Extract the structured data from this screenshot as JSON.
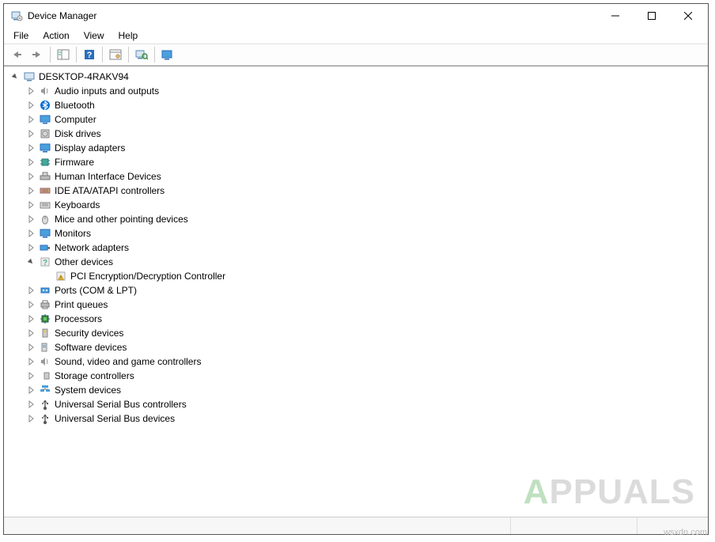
{
  "window": {
    "title": "Device Manager"
  },
  "menubar": {
    "items": [
      {
        "label": "File"
      },
      {
        "label": "Action"
      },
      {
        "label": "View"
      },
      {
        "label": "Help"
      }
    ]
  },
  "toolbar": {
    "buttons": [
      {
        "name": "back",
        "icon": "arrow-left"
      },
      {
        "name": "forward",
        "icon": "arrow-right"
      },
      {
        "name": "show-hide-tree",
        "icon": "tree-pane"
      },
      {
        "name": "help",
        "icon": "help-question"
      },
      {
        "name": "properties",
        "icon": "properties-gear"
      },
      {
        "name": "scan-hardware",
        "icon": "scan-computer"
      },
      {
        "name": "add-hardware",
        "icon": "monitor-plus"
      }
    ]
  },
  "tree": {
    "root": {
      "label": "DESKTOP-4RAKV94",
      "icon": "computer",
      "expanded": true
    },
    "categories": [
      {
        "label": "Audio inputs and outputs",
        "icon": "speaker",
        "expanded": false
      },
      {
        "label": "Bluetooth",
        "icon": "bluetooth",
        "expanded": false
      },
      {
        "label": "Computer",
        "icon": "monitor",
        "expanded": false
      },
      {
        "label": "Disk drives",
        "icon": "disk",
        "expanded": false
      },
      {
        "label": "Display adapters",
        "icon": "monitor",
        "expanded": false
      },
      {
        "label": "Firmware",
        "icon": "chip",
        "expanded": false
      },
      {
        "label": "Human Interface Devices",
        "icon": "hid",
        "expanded": false
      },
      {
        "label": "IDE ATA/ATAPI controllers",
        "icon": "ide",
        "expanded": false
      },
      {
        "label": "Keyboards",
        "icon": "keyboard",
        "expanded": false
      },
      {
        "label": "Mice and other pointing devices",
        "icon": "mouse",
        "expanded": false
      },
      {
        "label": "Monitors",
        "icon": "monitor",
        "expanded": false
      },
      {
        "label": "Network adapters",
        "icon": "network",
        "expanded": false
      },
      {
        "label": "Other devices",
        "icon": "unknown",
        "expanded": true,
        "children": [
          {
            "label": "PCI Encryption/Decryption Controller",
            "icon": "warning"
          }
        ]
      },
      {
        "label": "Ports (COM & LPT)",
        "icon": "port",
        "expanded": false
      },
      {
        "label": "Print queues",
        "icon": "printer",
        "expanded": false
      },
      {
        "label": "Processors",
        "icon": "cpu",
        "expanded": false
      },
      {
        "label": "Security devices",
        "icon": "security",
        "expanded": false
      },
      {
        "label": "Software devices",
        "icon": "software",
        "expanded": false
      },
      {
        "label": "Sound, video and game controllers",
        "icon": "speaker",
        "expanded": false
      },
      {
        "label": "Storage controllers",
        "icon": "storage",
        "expanded": false
      },
      {
        "label": "System devices",
        "icon": "system",
        "expanded": false
      },
      {
        "label": "Universal Serial Bus controllers",
        "icon": "usb",
        "expanded": false
      },
      {
        "label": "Universal Serial Bus devices",
        "icon": "usb",
        "expanded": false
      }
    ]
  },
  "watermark": {
    "text_a": "A",
    "text_ppuals": "PPUALS"
  },
  "attribution": "wsxdn.com"
}
